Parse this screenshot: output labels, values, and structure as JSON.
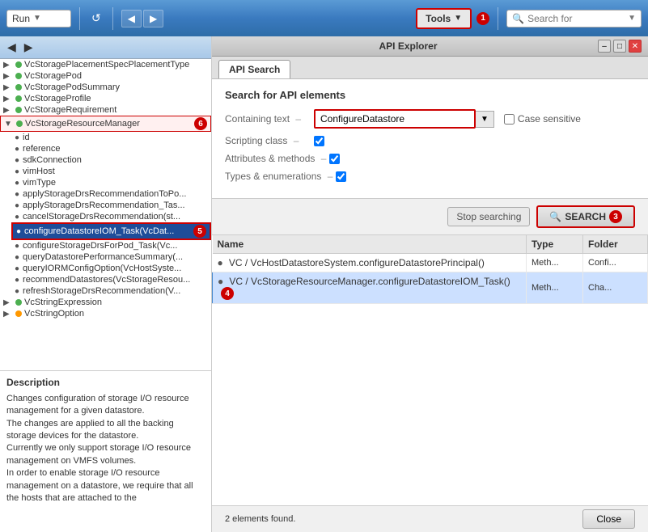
{
  "toolbar": {
    "run_label": "Run",
    "run_arrow": "▼",
    "tools_label": "Tools",
    "tools_arrow": "▼",
    "tools_badge": "1",
    "search_placeholder": "Search for",
    "search_dropdown": "▼"
  },
  "explorer": {
    "title": "API Explorer",
    "tabs": [
      {
        "label": "API Search",
        "active": true
      }
    ],
    "win_btns": [
      "–",
      "□",
      "✕"
    ]
  },
  "search_panel": {
    "title": "Search for API elements",
    "containing_text_label": "Containing text",
    "containing_text_value": "ConfigureDatastore",
    "case_sensitive_label": "Case sensitive",
    "scripting_class_label": "Scripting class",
    "attributes_label": "Attributes & methods",
    "types_label": "Types & enumerations",
    "stop_label": "Stop searching",
    "search_label": "SEARCH",
    "search_icon": "🔍",
    "search_badge": "3"
  },
  "results": {
    "columns": [
      "Name",
      "Type",
      "Folder"
    ],
    "rows": [
      {
        "name": "VC / VcHostDatastoreSystem.configureDatastorePrincipal()",
        "type": "Meth...",
        "folder": "Confi...",
        "selected": false
      },
      {
        "name": "VC / VcStorageResourceManager.configureDatastoreIOM_Task()",
        "type": "Meth...",
        "folder": "Cha...",
        "selected": true
      }
    ],
    "status": "2 elements found."
  },
  "left_panel": {
    "tree_items": [
      {
        "label": "VcStoragePlacementSpecPlacementType",
        "dot": "green",
        "expanded": false
      },
      {
        "label": "VcStoragePod",
        "dot": "green",
        "expanded": false
      },
      {
        "label": "VcStoragePodSummary",
        "dot": "green",
        "expanded": false
      },
      {
        "label": "VcStorageProfile",
        "dot": "green",
        "expanded": false
      },
      {
        "label": "VcStorageRequirement",
        "dot": "green",
        "expanded": false
      },
      {
        "label": "VcStorageResourceManager",
        "dot": "green",
        "expanded": true,
        "selected_parent": true,
        "children": [
          "id",
          "reference",
          "sdkConnection",
          "vimHost",
          "vimType",
          "applyStorageDrsRecommendationToPo...",
          "applyStorageDrsRecommendation_Tas...",
          "cancelStorageDrsRecommendation(st...",
          "configureDatastoreIOM_Task(VcDat...",
          "configureStorageDrsForPod_Task(Vc...",
          "queryDatastorePerformanceSummary(...",
          "queryIORMConfigOption(VcHostSyste...",
          "recommendDatastores(VcStorageResou...",
          "refreshStorageDrsRecommendation(V..."
        ]
      },
      {
        "label": "VcStringExpression",
        "dot": "green",
        "expanded": false
      },
      {
        "label": "VcStringOption",
        "dot": "orange",
        "expanded": false
      }
    ],
    "selected_child": "configureDatastoreIOM_Task(VcDat..."
  },
  "description": {
    "title": "Description",
    "text": "Changes configuration of storage I/O resource management for a given datastore.\nThe changes are applied to all the backing storage devices for the datastore.\nCurrently we only support storage I/O resource management on VMFS volumes.\nIn order to enable storage I/O resource management on a datastore, we require that all the hosts that are attached to the"
  }
}
